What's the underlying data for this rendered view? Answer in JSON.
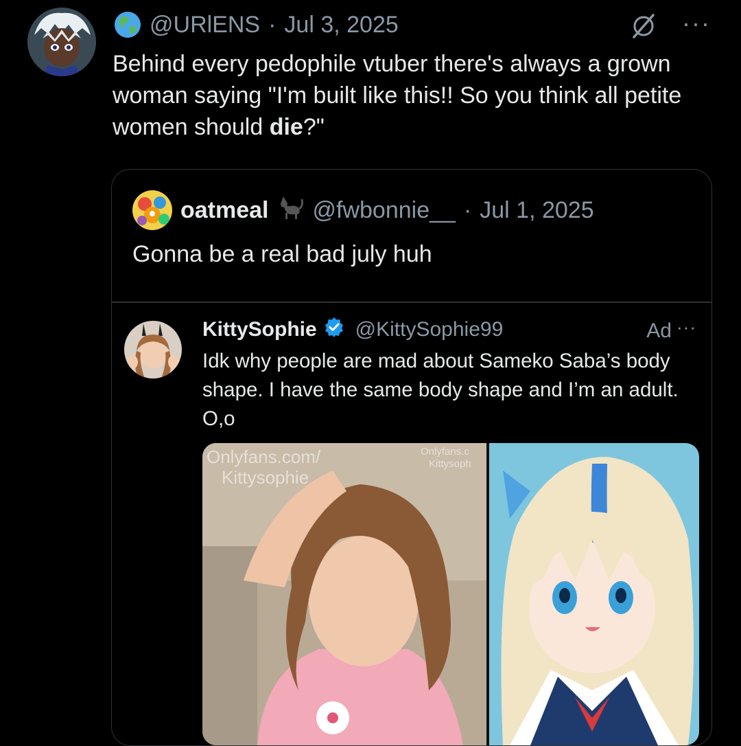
{
  "tweet": {
    "handle": "@URlENS",
    "separator": "·",
    "date": "Jul 3, 2025",
    "more": "···",
    "text_before_bold": "Behind every pedophile vtuber there's always a grown woman saying \"I'm built like this!! So you think all petite women should ",
    "text_bold": "die",
    "text_after_bold": "?\""
  },
  "quote": {
    "display_name": "oatmeal",
    "handle": "@fwbonnie__",
    "separator": "·",
    "date": "Jul 1, 2025",
    "text": "Gonna be a real bad july huh"
  },
  "inner_tweet": {
    "display_name": "KittySophie",
    "handle": "@KittySophie99",
    "ad_label": "Ad",
    "more": "···",
    "text": "Idk why people are mad about Sameko Saba’s body shape. I have the same body shape and I’m an adult. O,o",
    "watermark_left_line1": "Onlyfans.com/",
    "watermark_left_line2": "Kittysophie",
    "watermark_right_line1": "Onlyfans.c",
    "watermark_right_line2": "Kittysoph"
  },
  "icons": {
    "globe": "globe-icon",
    "grok": "grok-icon",
    "cat": "black-cat-icon",
    "verified": "verified-badge-icon"
  },
  "colors": {
    "background": "#000000",
    "text": "#e7e9ea",
    "secondary": "#8b98a5",
    "border": "#2f3336",
    "verified": "#1d9bf0"
  }
}
